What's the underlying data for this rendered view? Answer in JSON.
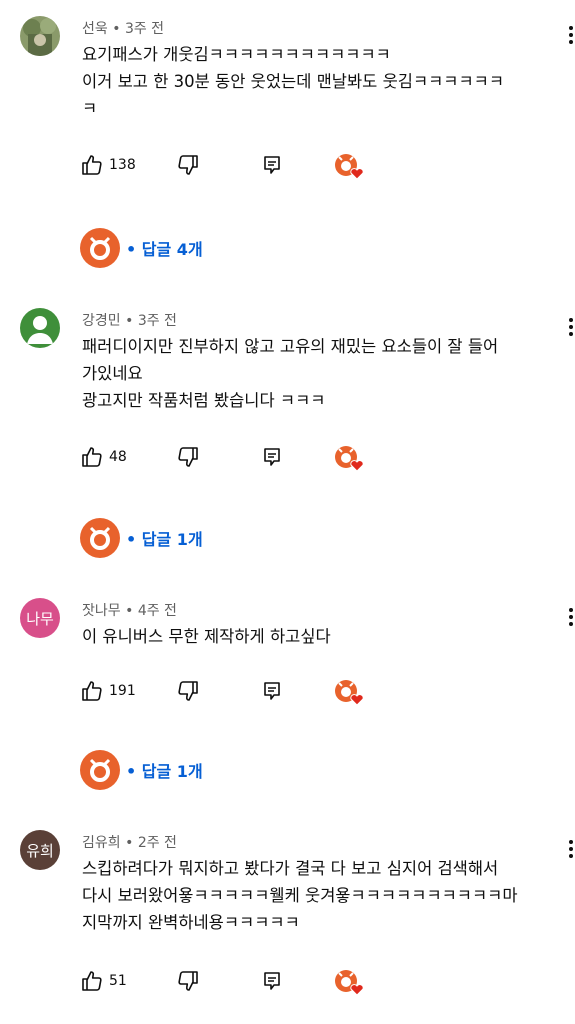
{
  "colors": {
    "accent": "#065fd4",
    "meta": "#606060",
    "creator_orange": "#e8622c",
    "heart": "#e0291c"
  },
  "comments": [
    {
      "author": "선욱",
      "time": "3주 전",
      "lines": [
        "요기패스가 개웃김ㅋㅋㅋㅋㅋㅋㅋㅋㅋㅋㅋㅋ",
        "이거 보고 한 30분 동안 웃었는데 맨날봐도 웃김ㅋㅋㅋㅋㅋㅋ",
        "ㅋ"
      ],
      "likes": "138",
      "replies": "답글 4개",
      "avatar": {
        "type": "photo"
      }
    },
    {
      "author": "강경민",
      "time": "3주 전",
      "lines": [
        "패러디이지만 진부하지 않고 고유의 재밌는 요소들이 잘 들어",
        "가있네요",
        "광고지만 작품처럼 봤습니다 ㅋㅋㅋ"
      ],
      "likes": "48",
      "replies": "답글 1개",
      "avatar": {
        "type": "default",
        "color": "#3f8f3a"
      }
    },
    {
      "author": "잣나무",
      "time": "4주 전",
      "lines": [
        "이 유니버스 무한 제작하게 하고싶다"
      ],
      "likes": "191",
      "replies": "답글 1개",
      "avatar": {
        "type": "initial",
        "text": "나무",
        "color": "#d84f8a"
      }
    },
    {
      "author": "김유희",
      "time": "2주 전",
      "lines": [
        "스킵하려다가 뭐지하고 봤다가 결국 다 보고 심지어 검색해서",
        "다시 보러왔어욯ㅋㅋㅋㅋㅋ웰케 웃겨욯ㅋㅋㅋㅋㅋㅋㅋㅋㅋㅋ마",
        "지막까지 완벽하네용ㅋㅋㅋㅋㅋ"
      ],
      "likes": "51",
      "replies": null,
      "avatar": {
        "type": "initial",
        "text": "유희",
        "color": "#5a4037"
      }
    }
  ]
}
